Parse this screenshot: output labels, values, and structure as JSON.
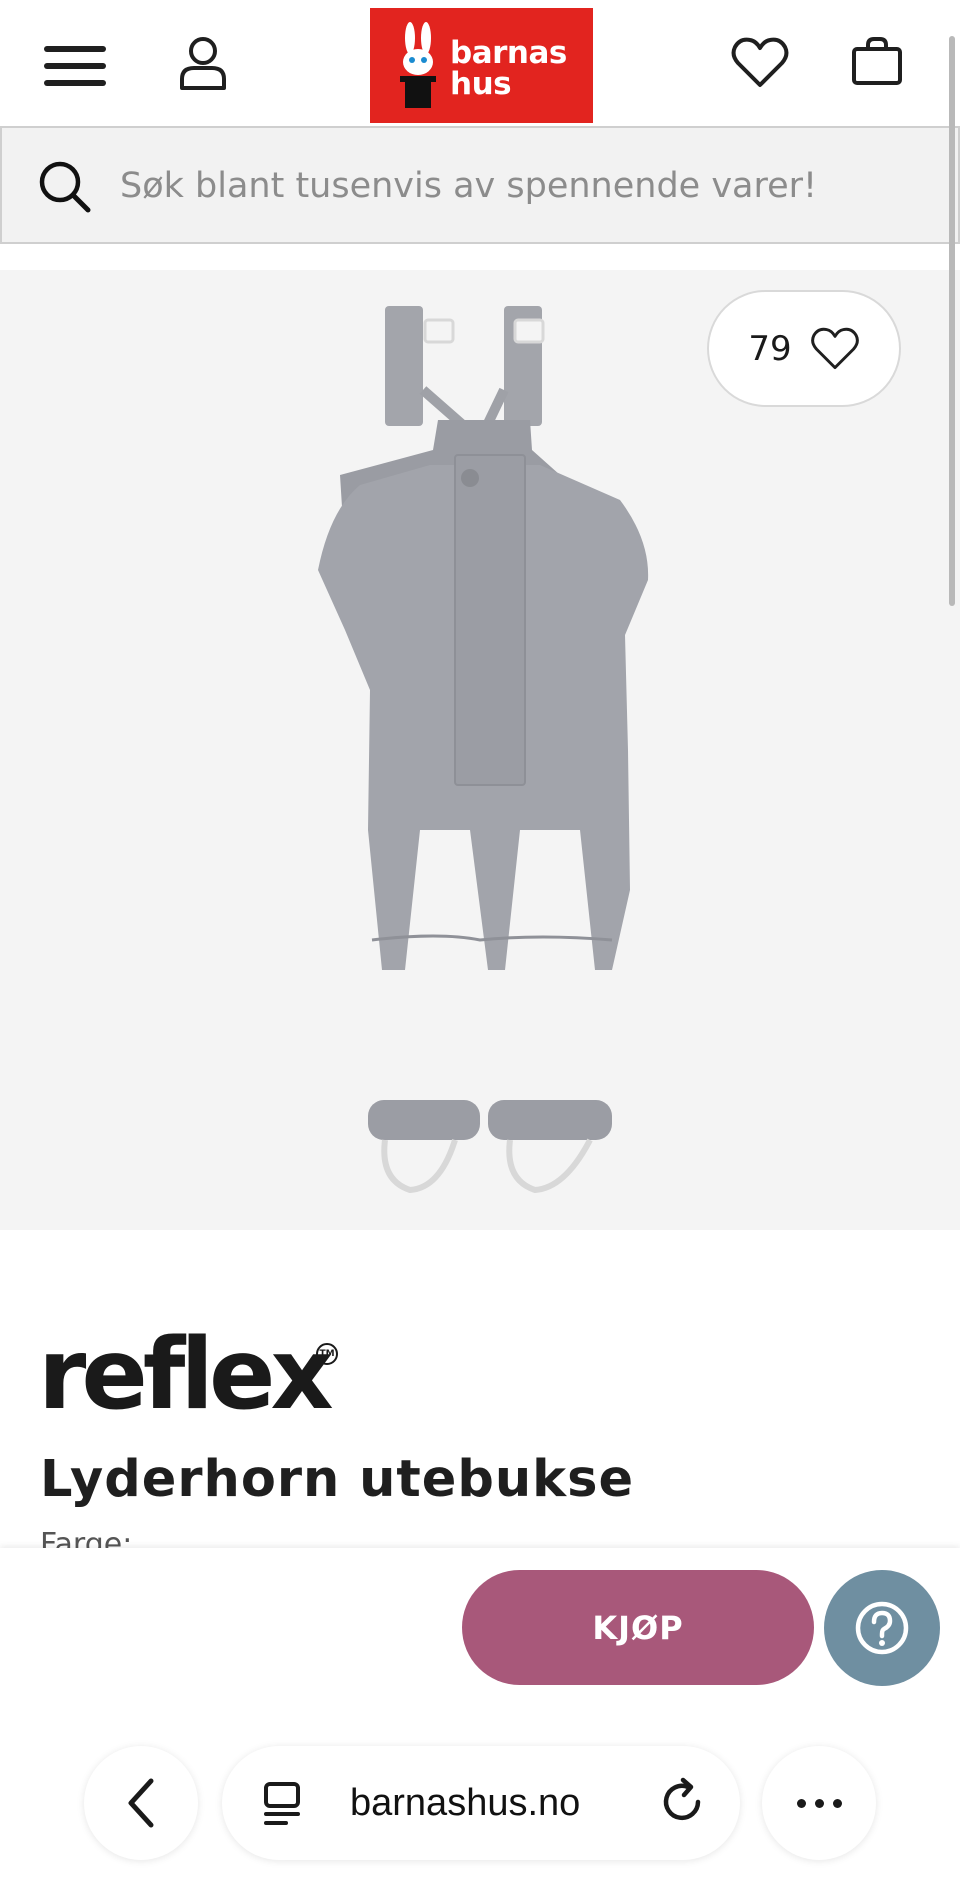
{
  "header": {
    "logo": {
      "line1": "barnas",
      "line2": "hus",
      "color": "#e2241f"
    },
    "icons": [
      "menu-icon",
      "user-icon",
      "heart-icon",
      "shopping-bag-icon"
    ]
  },
  "search": {
    "placeholder": "Søk blant tusenvis av spennende varer!",
    "icon": "search-icon"
  },
  "product": {
    "like_count": "79",
    "brand": "reflex",
    "brand_tm": "TM",
    "title": "Lyderhorn utebukse",
    "subtitle_partial": "Farge: ..."
  },
  "actions": {
    "buy_label": "KJØP",
    "buy_color": "#a8587a",
    "help_icon": "question-circle-icon",
    "help_color": "#6f8fa1"
  },
  "browser": {
    "url": "barnashus.no",
    "icons": [
      "back-icon",
      "tabs-icon",
      "reload-icon",
      "more-icon"
    ]
  }
}
